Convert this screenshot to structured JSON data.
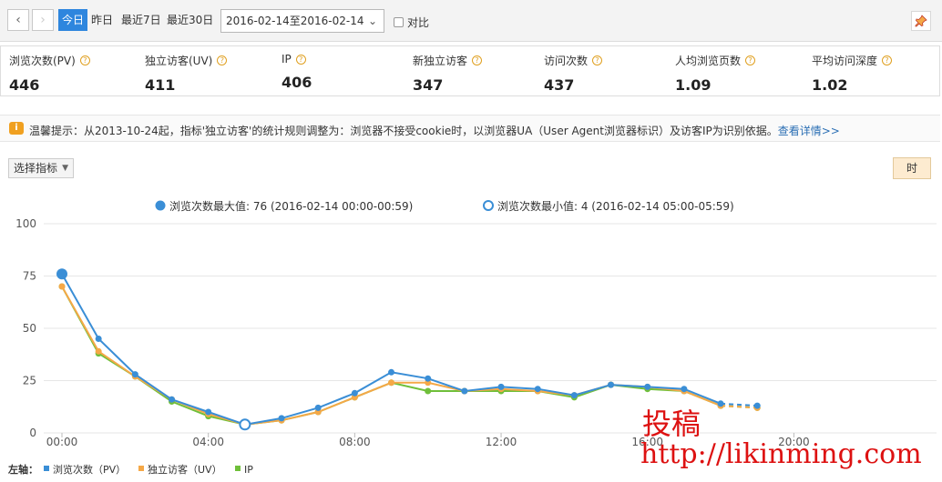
{
  "toolbar": {
    "prev_icon": "‹",
    "next_icon": "›",
    "ranges": [
      "今日",
      "昨日",
      "最近7日",
      "最近30日"
    ],
    "date_range": "2016-02-14至2016-02-14",
    "compare_label": "对比",
    "pin_icon": "pin-icon"
  },
  "metrics": [
    {
      "label": "浏览次数(PV)",
      "value": "446",
      "help": true
    },
    {
      "label": "独立访客(UV)",
      "value": "411",
      "help": true
    },
    {
      "label": "IP",
      "value": "406",
      "help": true
    },
    {
      "label": "新独立访客",
      "value": "347",
      "help": true
    },
    {
      "label": "访问次数",
      "value": "437",
      "help": true
    },
    {
      "label": "人均浏览页数",
      "value": "1.09",
      "help": true
    },
    {
      "label": "平均访问深度",
      "value": "1.02",
      "help": true
    }
  ],
  "tip": {
    "text": "温馨提示：从2013-10-24起，指标'独立访客'的统计规则调整为：浏览器不接受cookie时，以浏览器UA（User Agent浏览器标识）及访客IP为识别依据。",
    "link": "查看详情>>"
  },
  "controls": {
    "metric_select": "选择指标",
    "granularity": "时"
  },
  "colors": {
    "pv": "#3a8ed6",
    "uv": "#f5a847",
    "ip": "#6fbf3a",
    "grid": "#e6e6e6",
    "active_tab": "#2e86de"
  },
  "chart_data": {
    "type": "line",
    "x": [
      "00:00",
      "01:00",
      "02:00",
      "03:00",
      "04:00",
      "05:00",
      "06:00",
      "07:00",
      "08:00",
      "09:00",
      "10:00",
      "11:00",
      "12:00",
      "13:00",
      "14:00",
      "15:00",
      "16:00",
      "17:00",
      "18:00",
      "19:00"
    ],
    "x_ticks": [
      "00:00",
      "04:00",
      "08:00",
      "12:00",
      "16:00",
      "20:00"
    ],
    "y_ticks": [
      0,
      25,
      50,
      75,
      100
    ],
    "ylim": [
      0,
      100
    ],
    "grid": true,
    "series": [
      {
        "key": "pv",
        "values": [
          76,
          45,
          28,
          16,
          10,
          4,
          7,
          12,
          19,
          29,
          26,
          20,
          22,
          21,
          18,
          23,
          22,
          21,
          14,
          13
        ]
      },
      {
        "key": "uv",
        "values": [
          70,
          39,
          27,
          16,
          9,
          4,
          6,
          10,
          17,
          24,
          24,
          20,
          21,
          20,
          18,
          23,
          22,
          20,
          13,
          12
        ]
      },
      {
        "key": "ip",
        "values": [
          70,
          38,
          27,
          15,
          8,
          4,
          6,
          10,
          17,
          24,
          20,
          20,
          20,
          20,
          17,
          23,
          21,
          20,
          13,
          12
        ]
      }
    ],
    "dashed_from_index": 18,
    "annotations": {
      "max_label": "浏览次数最大值: 76 (2016-02-14 00:00-00:59)",
      "min_label": "浏览次数最小值: 4 (2016-02-14 05:00-05:59)",
      "max_index": 0,
      "min_index": 5
    },
    "legend": {
      "prefix": "左轴：",
      "items": [
        "浏览次数（PV）",
        "独立访客（UV）",
        "IP"
      ],
      "placement": "bottom-left"
    }
  },
  "watermark": {
    "line1": "投稿",
    "line2": "http://likinming.com"
  }
}
